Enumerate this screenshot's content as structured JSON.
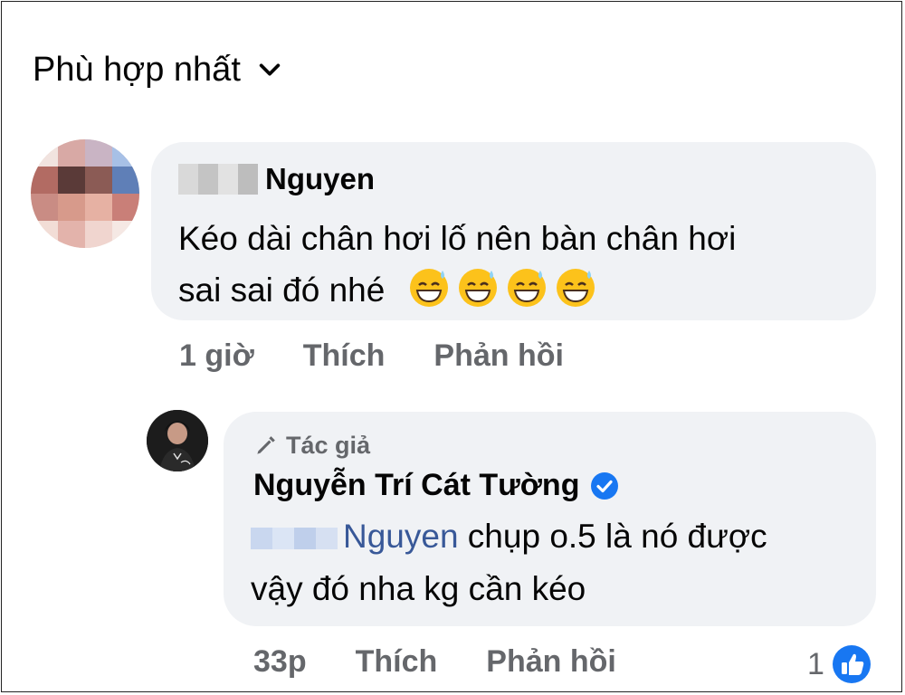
{
  "sort": {
    "label": "Phù hợp nhất",
    "icon": "chevron-down-icon"
  },
  "comment": {
    "author_visible": "Nguyen",
    "text_line1": "Kéo dài chân hơi lố nên bàn chân hơi",
    "text_line2": "sai sai đó nhé",
    "emoji_icon": "grinning-sweat-emoji",
    "time": "1 giờ",
    "like_label": "Thích",
    "reply_label": "Phản hồi"
  },
  "reply": {
    "badge": "Tác giả",
    "author": "Nguyễn Trí Cát Tường",
    "mention": "Nguyen",
    "text_line1": " chụp o.5 là nó được",
    "text_line2": "vậy đó nha kg cần kéo",
    "time": "33p",
    "like_label": "Thích",
    "reply_label": "Phản hồi",
    "reaction_count": "1"
  },
  "colors": {
    "bubble": "#f0f2f5",
    "meta": "#65676b",
    "accent": "#1877f2",
    "mention": "#385898"
  }
}
